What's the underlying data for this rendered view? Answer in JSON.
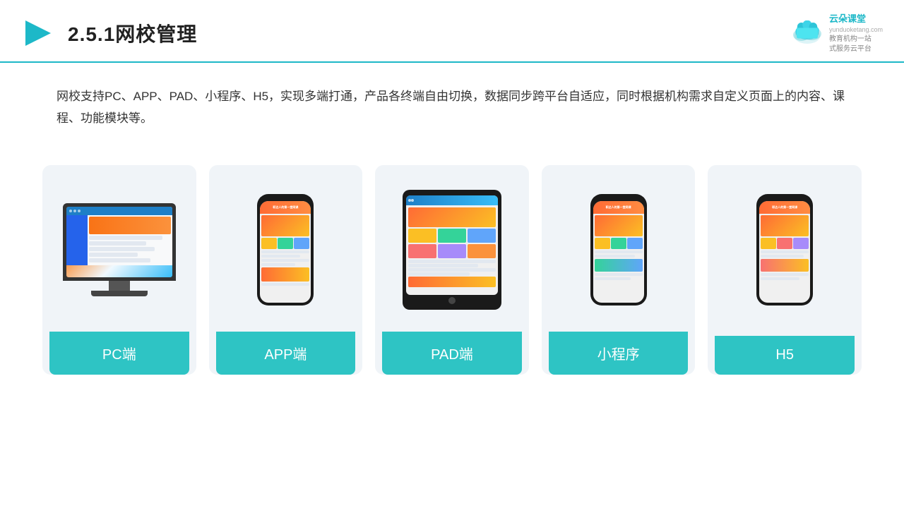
{
  "header": {
    "title": "2.5.1网校管理",
    "brand_name": "云朵课堂",
    "brand_url": "yunduoketang.com",
    "brand_tagline1": "教育机构一站",
    "brand_tagline2": "式服务云平台"
  },
  "description": {
    "text": "网校支持PC、APP、PAD、小程序、H5，实现多端打通，产品各终端自由切换，数据同步跨平台自适应，同时根据机构需求自定义页面上的内容、课程、功能模块等。"
  },
  "cards": [
    {
      "id": "pc",
      "label": "PC端"
    },
    {
      "id": "app",
      "label": "APP端"
    },
    {
      "id": "pad",
      "label": "PAD端"
    },
    {
      "id": "miniprogram",
      "label": "小程序"
    },
    {
      "id": "h5",
      "label": "H5"
    }
  ],
  "colors": {
    "accent": "#2ec4c4",
    "header_line": "#1db8c8",
    "brand": "#1db8c8",
    "card_bg": "#eef2f8"
  }
}
